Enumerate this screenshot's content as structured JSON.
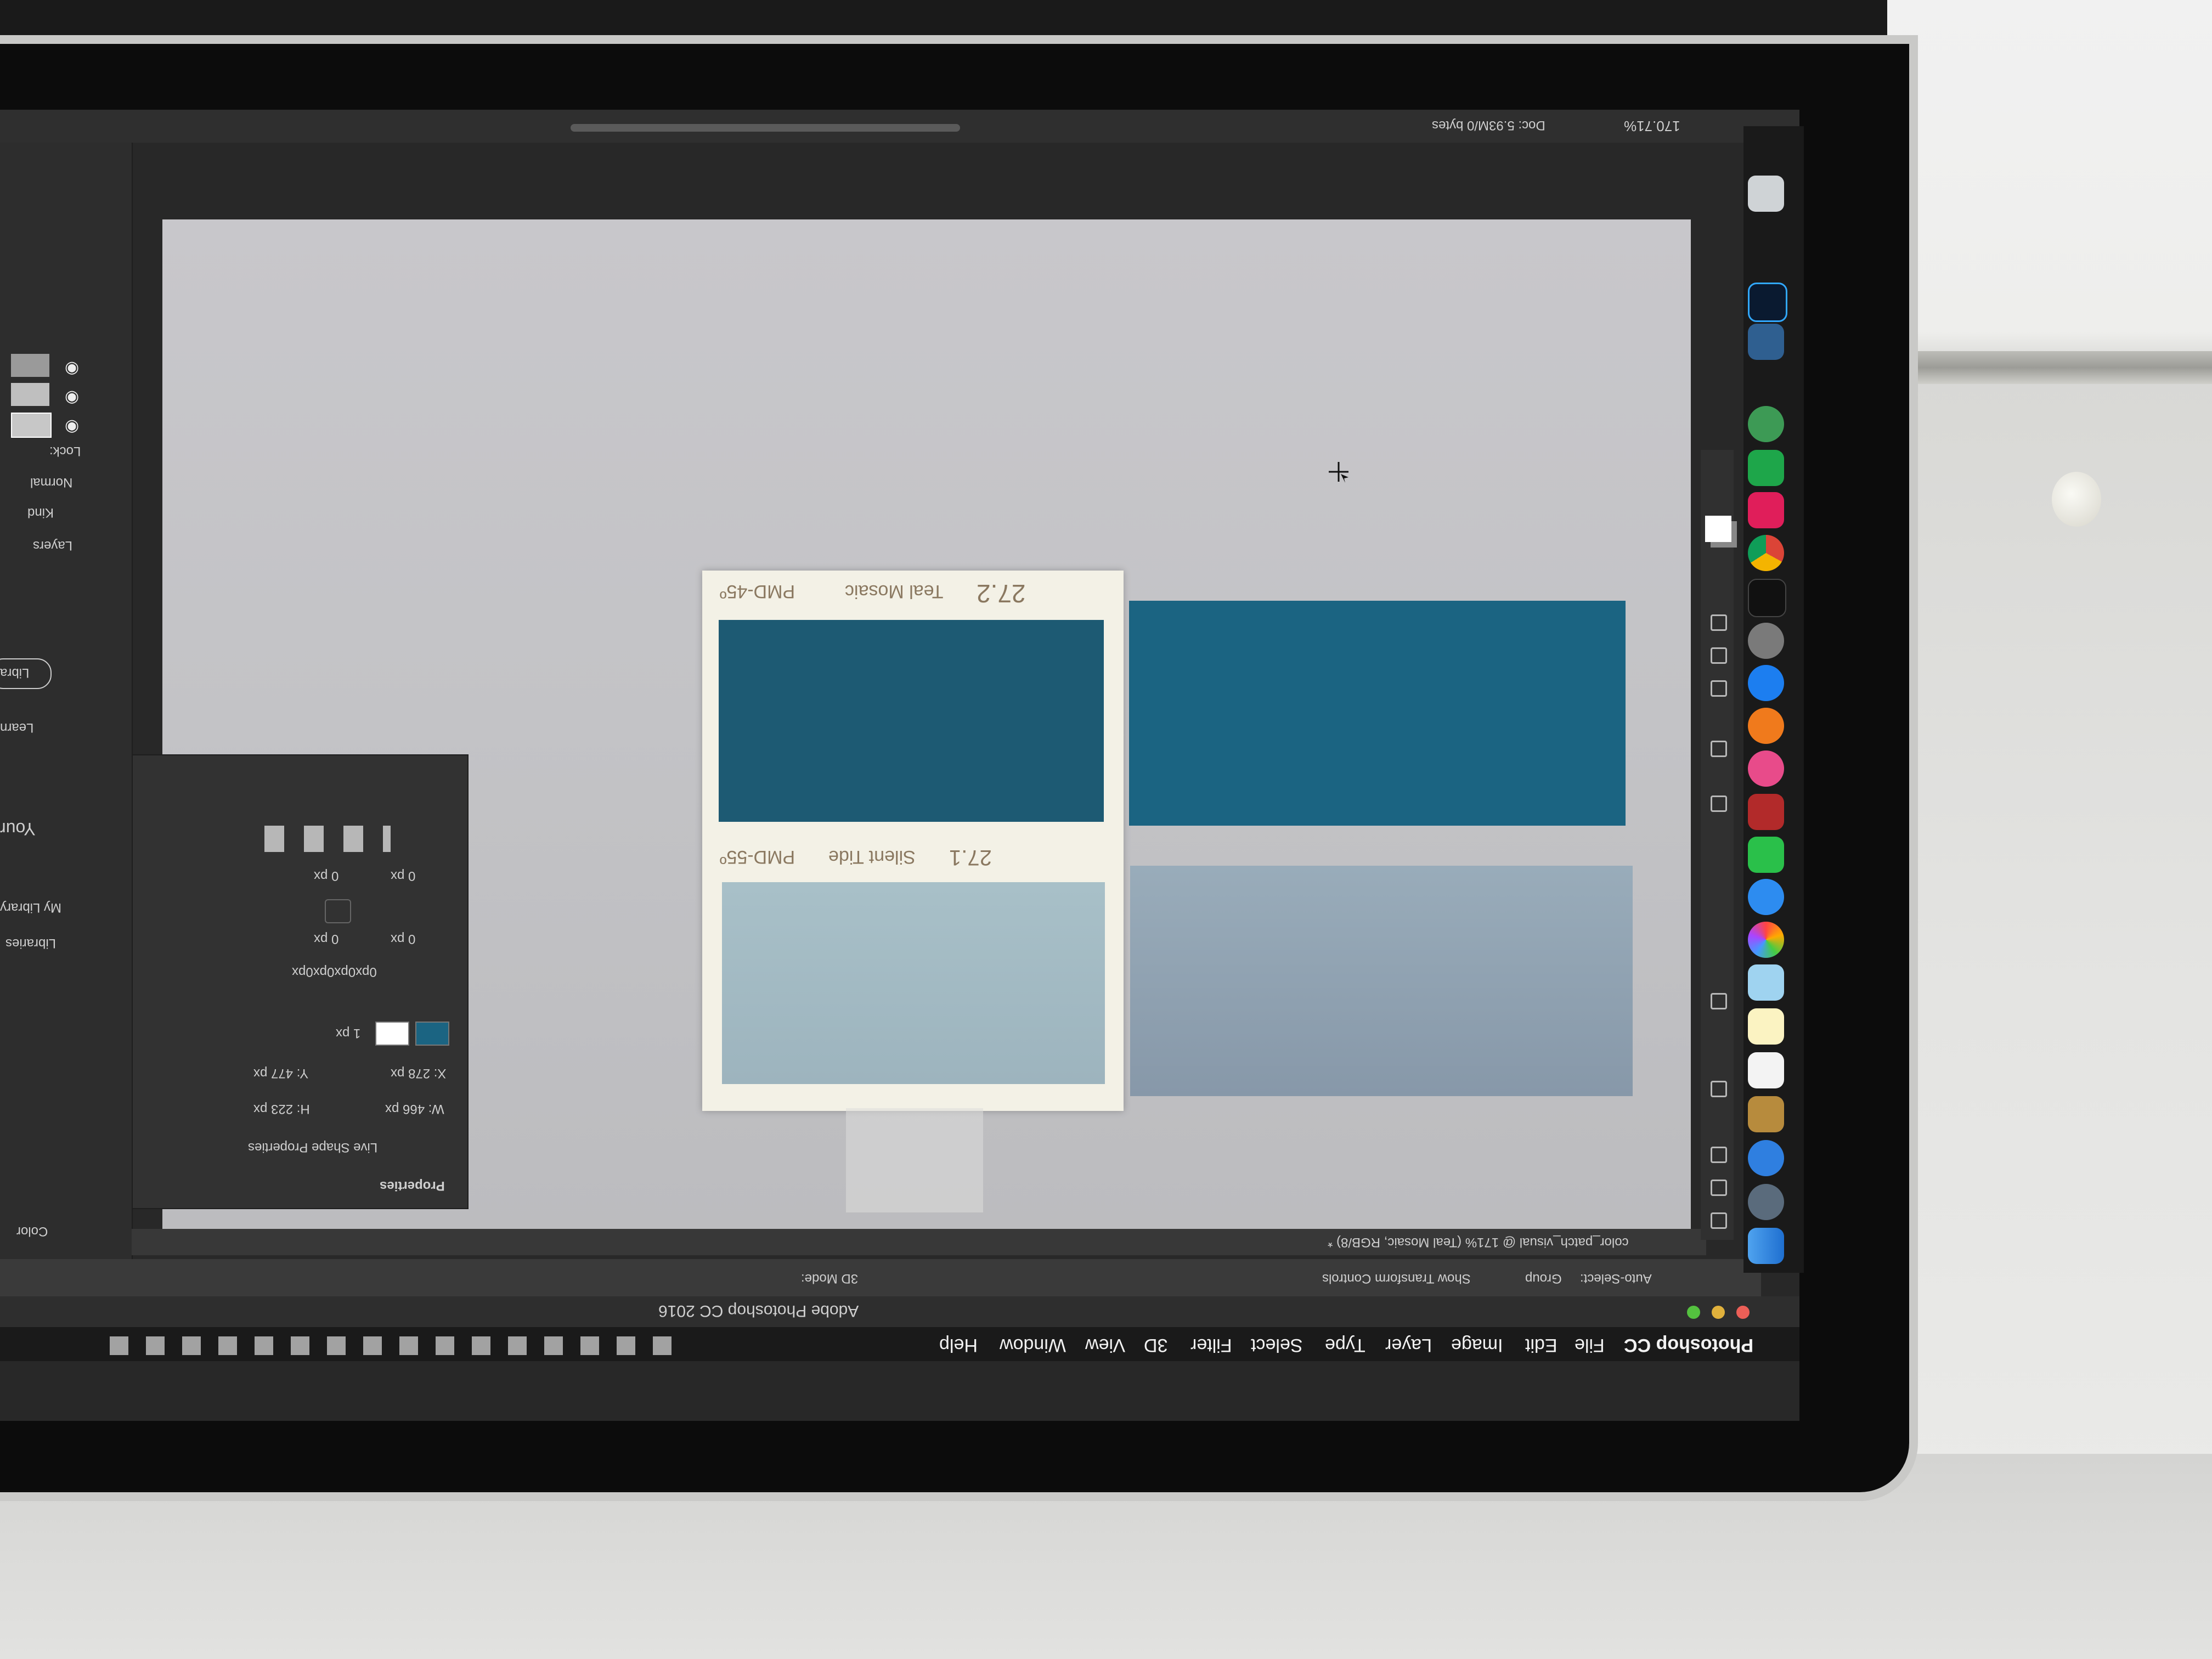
{
  "menubar": {
    "app": "Photoshop CC",
    "items": [
      "File",
      "Edit",
      "Image",
      "Layer",
      "Type",
      "Select",
      "Filter",
      "3D",
      "View",
      "Window",
      "Help"
    ]
  },
  "window_title": "Adobe Photoshop CC 2016",
  "document_tab": "color_patch_visual @ 171% (Teal Mosaic, RGB/8) *",
  "status_bar": {
    "zoom": "170.71%",
    "doc": "Doc: 5.93M/0 bytes"
  },
  "options_bar": {
    "auto_select": "Auto-Select:",
    "group": "Group",
    "show_transform": "Show Transform Controls",
    "mode_3d": "3D Mode:"
  },
  "swatches": {
    "top_label_number": "27.2",
    "top_label_name": "Teal Mosaic",
    "top_label_code": "PMD-45º",
    "bottom_label_number": "27.1",
    "bottom_label_name": "Silent Tide",
    "bottom_label_code": "PMD-55º"
  },
  "properties_panel": {
    "title": "Properties",
    "live_shape": "Live Shape Properties",
    "w": "W: 466 px",
    "h": "H: 223 px",
    "x": "X: 278 px",
    "y": "Y: 477 px",
    "stroke": "1 px",
    "corner_values": [
      "0 px",
      "0 px",
      "0 px",
      "0 px"
    ],
    "corner_text": "0px0px0px0px"
  },
  "left_panels": {
    "layers": "Layers",
    "kind": "Kind",
    "normal": "Normal",
    "lock": "Lock:",
    "libraries": "Libraries",
    "my_library": "My Library",
    "your": "Your",
    "learn": "Learn",
    "libraries_button": "Libra",
    "color": "Color"
  },
  "colors": {
    "teal_mosaic_screen": "#1b6482",
    "teal_mosaic_card": "#1d5a73",
    "silent_tide_screen": "#8ea3b3",
    "silent_tide_card": "#a5bcc5",
    "canvas": "#c5c6c8",
    "ps_dark": "#2b2b2b"
  },
  "dock_icons": [
    "finder-icon",
    "photoshop-icon",
    "blender-icon",
    "atom-icon",
    "sourcetree-icon",
    "slack-icon",
    "chrome-icon",
    "terminal-icon",
    "system-preferences-icon",
    "app-store-icon",
    "books-icon",
    "itunes-icon",
    "photo-booth-icon",
    "facetime-icon",
    "messages-icon",
    "photos-icon",
    "preview-icon",
    "calendar-icon",
    "notes-icon",
    "safari-icon",
    "launchpad-icon",
    "trash-icon"
  ]
}
